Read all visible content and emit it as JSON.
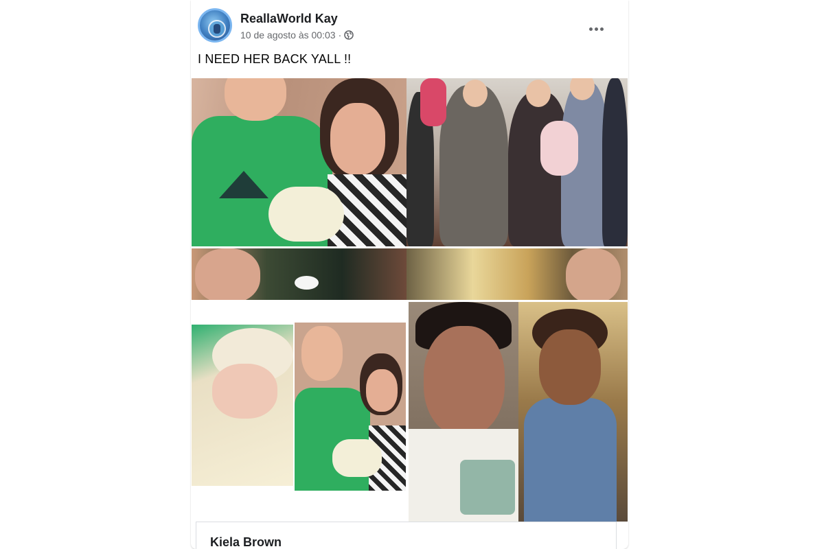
{
  "post": {
    "author": "ReallaWorld Kay",
    "timestamp": "10 de agosto às 00:03",
    "separator": "·",
    "privacy_icon": "globe-icon",
    "more_icon": "more-horizontal-icon",
    "text": "I NEED HER BACK YALL !!"
  },
  "photos": [
    {
      "label": "couple-holding-newborn"
    },
    {
      "label": "family-group-with-babies"
    },
    {
      "label": "close-up-strip-left"
    },
    {
      "label": "close-up-strip-right"
    },
    {
      "label": "newborn-and-couple-collage"
    },
    {
      "label": "young-man-and-toddler"
    }
  ],
  "comment": {
    "name": "Kiela Brown"
  },
  "colors": {
    "meta_gray": "#65676b",
    "text_dark": "#050505",
    "border": "#dadde1"
  }
}
